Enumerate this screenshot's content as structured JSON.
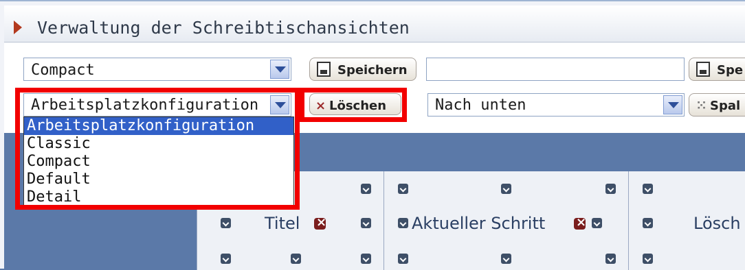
{
  "window": {
    "title": "Verwaltung der Schreibtischansichten"
  },
  "row1": {
    "view_select": "Compact",
    "save_button": "Speichern",
    "text_value": "",
    "save_button_2": "Spe"
  },
  "row2": {
    "config_select": "Arbeitsplatzkonfiguration",
    "delete_button": "Löschen",
    "position_select": "Nach unten",
    "column_button": "Spal"
  },
  "dropdown_options": [
    "Arbeitsplatzkonfiguration",
    "Classic",
    "Compact",
    "Default",
    "Detail"
  ],
  "columns": {
    "col1": "Titel",
    "col2": "Aktueller Schritt",
    "col3": "Lösch"
  },
  "icons": {
    "title_arrow": "arrow-right-icon",
    "save": "floppy-disk-icon",
    "delete": "x-icon",
    "column": "column-icon"
  }
}
